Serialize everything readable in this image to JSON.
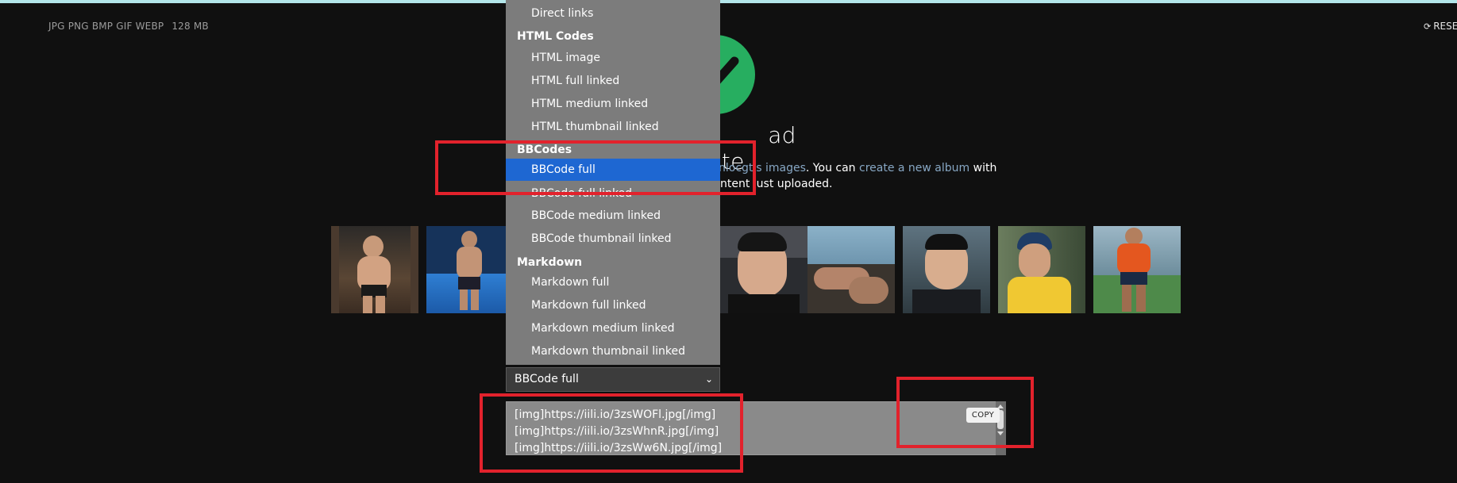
{
  "header": {
    "formats": "JPG PNG BMP GIF WEBP",
    "max_size": "128 MB",
    "reset_label": "RESE",
    "reset_icon": "refresh-icon"
  },
  "status": {
    "icon": "checkmark-icon",
    "icon_color": "#27ae60",
    "title_visible": "ad complete",
    "info_line1_prefix": "nlocgt's images",
    "info_line1_mid": ". You can ",
    "info_line1_link": "create a new album",
    "info_line1_suffix": " with",
    "info_line2": "ntent just uploaded."
  },
  "dropdown": {
    "items": [
      {
        "type": "option",
        "label": "Direct links"
      },
      {
        "type": "group",
        "label": "HTML Codes"
      },
      {
        "type": "option",
        "label": "HTML image"
      },
      {
        "type": "option",
        "label": "HTML full linked"
      },
      {
        "type": "option",
        "label": "HTML medium linked"
      },
      {
        "type": "option",
        "label": "HTML thumbnail linked"
      },
      {
        "type": "group",
        "label": "BBCodes"
      },
      {
        "type": "option",
        "label": "BBCode full",
        "selected": true
      },
      {
        "type": "option",
        "label": "BBCode full linked"
      },
      {
        "type": "option",
        "label": "BBCode medium linked"
      },
      {
        "type": "option",
        "label": "BBCode thumbnail linked"
      },
      {
        "type": "group",
        "label": "Markdown"
      },
      {
        "type": "option",
        "label": "Markdown full"
      },
      {
        "type": "option",
        "label": "Markdown full linked"
      },
      {
        "type": "option",
        "label": "Markdown medium linked"
      },
      {
        "type": "option",
        "label": "Markdown thumbnail linked"
      }
    ],
    "selected_value": "BBCode full",
    "selected_color": "#1e67d2"
  },
  "codebox": {
    "lines": [
      "[img]https://iili.io/3zsWOFl.jpg[/img]",
      "[img]https://iili.io/3zsWhnR.jpg[/img]",
      "[img]https://iili.io/3zsWw6N.jpg[/img]"
    ],
    "copy_label": "COPY"
  },
  "annotation_color": "#e2222c"
}
